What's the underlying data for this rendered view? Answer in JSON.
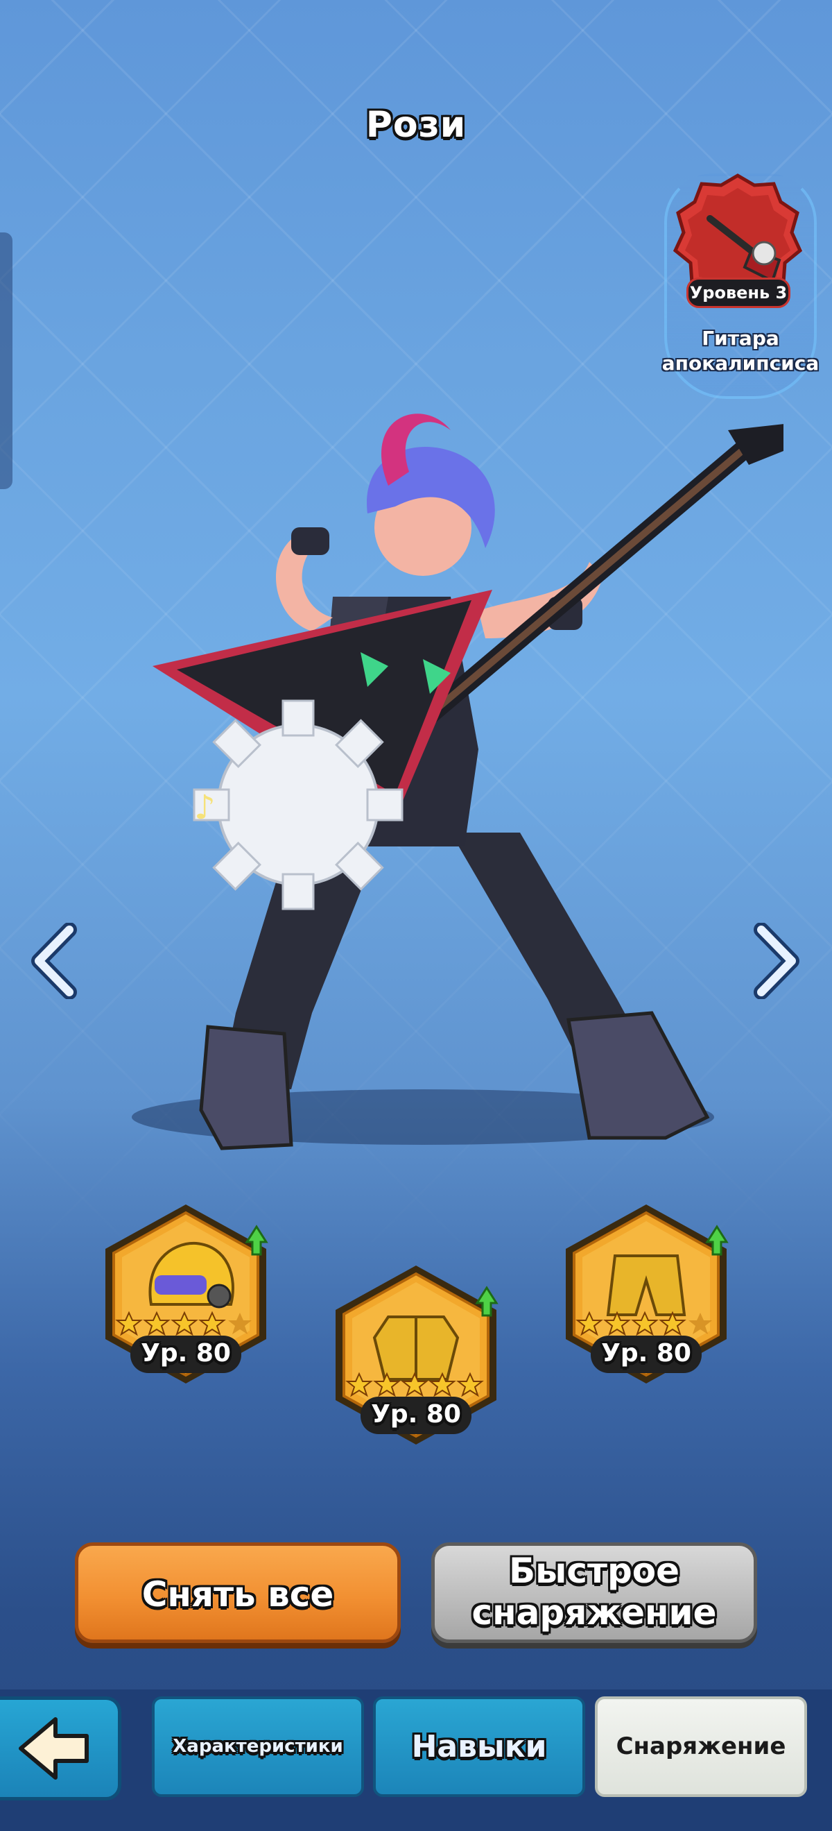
{
  "hero": {
    "name": "Рози"
  },
  "weapon": {
    "level_label": "Уровень 3",
    "name": "Гитара апокалипсиса",
    "icon": "guitar-icon",
    "frame_color": "#d93a35"
  },
  "gear": [
    {
      "slot": "helmet",
      "icon": "helmet-icon",
      "level": "Ур. 80",
      "stars": 4,
      "upgrade_available": true
    },
    {
      "slot": "armor",
      "icon": "armor-icon",
      "level": "Ур. 80",
      "stars": 5,
      "upgrade_available": true
    },
    {
      "slot": "pants",
      "icon": "pants-icon",
      "level": "Ур. 80",
      "stars": 4,
      "upgrade_available": true
    }
  ],
  "actions": {
    "remove_all": "Снять все",
    "quick_equip": "Быстрое снаряжение"
  },
  "tabs": [
    {
      "label": "Характеристики",
      "active": false
    },
    {
      "label": "Навыки",
      "active": false
    },
    {
      "label": "Снаряжение",
      "active": true
    }
  ],
  "colors": {
    "accent_orange": "#f29032",
    "gear_gold": "#f2a82c",
    "tab_blue": "#1c85b9"
  }
}
